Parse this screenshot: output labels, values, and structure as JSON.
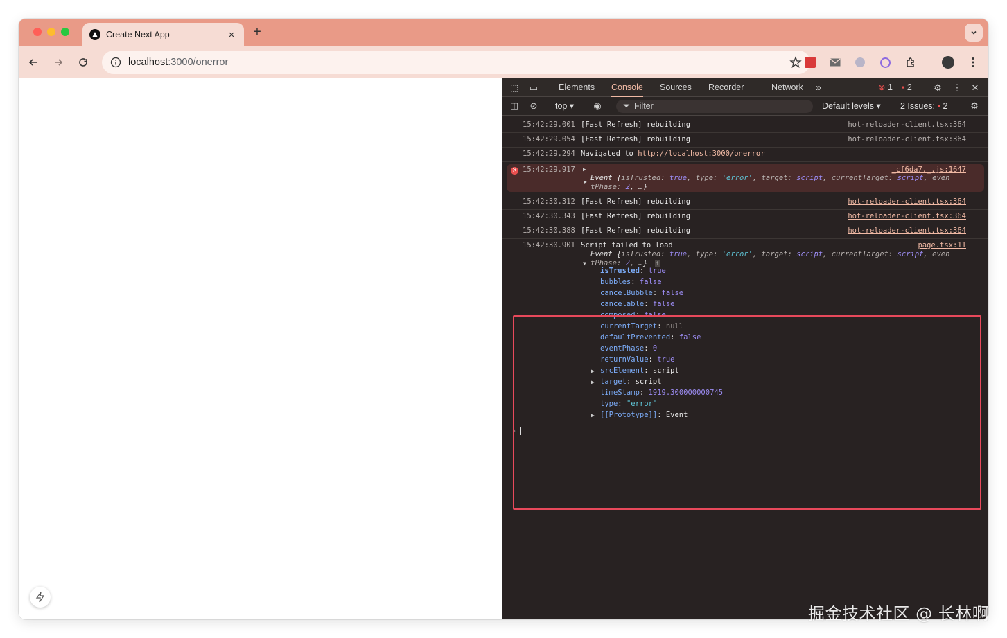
{
  "browser": {
    "tab_title": "Create Next App",
    "tab_close": "×",
    "new_tab": "+",
    "url_host": "localhost",
    "url_path": ":3000/onerror"
  },
  "devtools": {
    "tabs": [
      "Elements",
      "Console",
      "Sources",
      "Recorder",
      "Network"
    ],
    "active_tab": "Console",
    "more_tabs": "»",
    "error_count": "1",
    "issue_count": "2",
    "context": "top",
    "filter_placeholder": "Filter",
    "levels": "Default levels",
    "issues_label": "2 Issues:",
    "issues_badge": "2"
  },
  "console": {
    "rows": [
      {
        "ts": "15:42:29.001",
        "msg": "[Fast Refresh] rebuilding",
        "src": "hot-reloader-client.tsx:364"
      },
      {
        "ts": "15:42:29.054",
        "msg": "[Fast Refresh] rebuilding",
        "src": "hot-reloader-client.tsx:364"
      },
      {
        "ts": "15:42:29.294",
        "msg": "Navigated to ",
        "link": "http://localhost:3000/onerror"
      },
      {
        "ts": "15:42:29.917",
        "src": "_cf6da7._.js:1647"
      },
      {
        "ts": "15:42:30.312",
        "msg": "[Fast Refresh] rebuilding",
        "src": "hot-reloader-client.tsx:364"
      },
      {
        "ts": "15:42:30.343",
        "msg": "[Fast Refresh] rebuilding",
        "src": "hot-reloader-client.tsx:364"
      },
      {
        "ts": "15:42:30.388",
        "msg": "[Fast Refresh] rebuilding",
        "src": "hot-reloader-client.tsx:364"
      },
      {
        "ts": "15:42:30.901",
        "msg": "Script failed to load",
        "src": "page.tsx:11"
      }
    ],
    "event_line1": {
      "prefix": "Event {",
      "k1": "isTrusted: ",
      "v1": "true",
      "k2": ", type: ",
      "v2": "'error'",
      "k3": ", target: ",
      "v3": "script",
      "k4": ", currentTarget: ",
      "v4": "script",
      "k5": ", even"
    },
    "event_line2": {
      "k": "tPhase: ",
      "v": "2",
      "end": ", …}"
    },
    "info_icon": "i",
    "props": [
      {
        "key": "isTrusted",
        "val": "true",
        "type": "bool"
      },
      {
        "key": "bubbles",
        "val": "false",
        "type": "bool"
      },
      {
        "key": "cancelBubble",
        "val": "false",
        "type": "bool"
      },
      {
        "key": "cancelable",
        "val": "false",
        "type": "bool"
      },
      {
        "key": "composed",
        "val": "false",
        "type": "bool"
      },
      {
        "key": "currentTarget",
        "val": "null",
        "type": "null"
      },
      {
        "key": "defaultPrevented",
        "val": "false",
        "type": "bool"
      },
      {
        "key": "eventPhase",
        "val": "0",
        "type": "num"
      },
      {
        "key": "returnValue",
        "val": "true",
        "type": "bool"
      },
      {
        "key": "srcElement",
        "val": "script",
        "type": "obj"
      },
      {
        "key": "target",
        "val": "script",
        "type": "obj"
      },
      {
        "key": "timeStamp",
        "val": "1919.300000000745",
        "type": "num"
      },
      {
        "key": "type",
        "val": "\"error\"",
        "type": "str"
      },
      {
        "key": "[[Prototype]]",
        "val": "Event",
        "type": "obj"
      }
    ]
  },
  "watermark": "掘金技术社区 @ 长林啊"
}
